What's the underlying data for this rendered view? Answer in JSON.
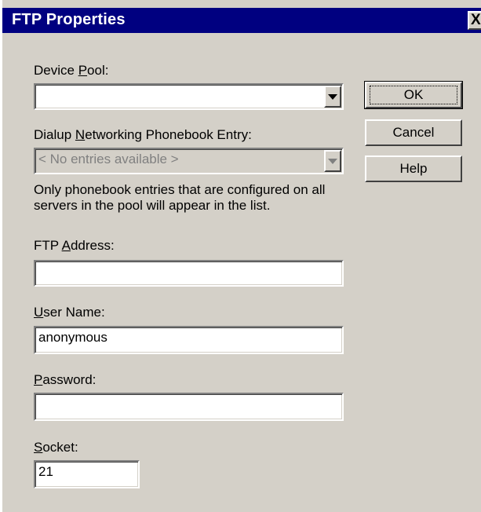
{
  "window": {
    "title": "FTP Properties",
    "close_glyph": "X"
  },
  "device_pool": {
    "label_pre": "Device ",
    "label_accel": "P",
    "label_post": "ool:",
    "value": ""
  },
  "dialup": {
    "label_pre": "Dialup ",
    "label_accel": "N",
    "label_post": "etworking Phonebook Entry:",
    "value": "< No entries available >",
    "hint": "Only phonebook entries that are configured on all servers in the pool will appear in the list."
  },
  "ftp_address": {
    "label_pre": "FTP ",
    "label_accel": "A",
    "label_post": "ddress:",
    "value": ""
  },
  "user_name": {
    "label_pre": "",
    "label_accel": "U",
    "label_post": "ser Name:",
    "value": "anonymous"
  },
  "password": {
    "label_pre": "",
    "label_accel": "P",
    "label_post": "assword:",
    "value": ""
  },
  "socket": {
    "label_pre": "",
    "label_accel": "S",
    "label_post": "ocket:",
    "value": "21"
  },
  "buttons": {
    "ok": "OK",
    "cancel": "Cancel",
    "help": "Help"
  }
}
